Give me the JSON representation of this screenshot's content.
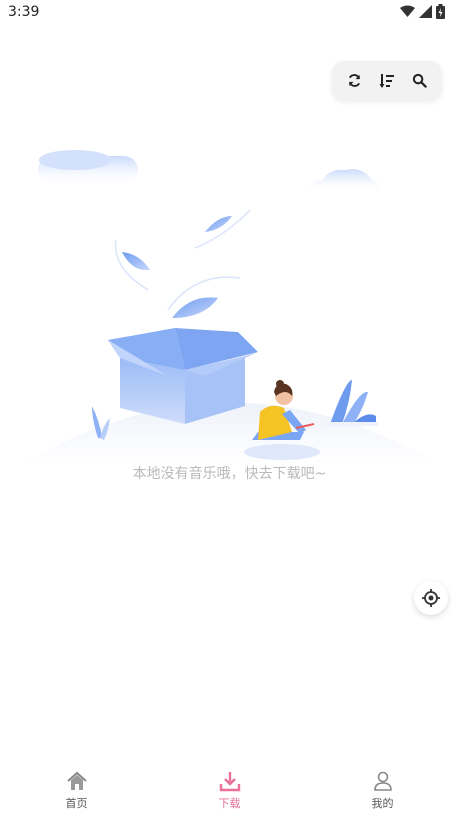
{
  "status_bar": {
    "time": "3:39",
    "icons": [
      "wifi-icon",
      "signal-icon",
      "battery-icon"
    ]
  },
  "toolbar": {
    "buttons": [
      "refresh-icon",
      "sort-icon",
      "search-icon"
    ]
  },
  "empty_state": {
    "message": "本地没有音乐哦，快去下载吧~"
  },
  "bottom_nav": {
    "items": [
      {
        "label": "首页",
        "icon": "home-icon",
        "active": false
      },
      {
        "label": "下载",
        "icon": "download-icon",
        "active": true
      },
      {
        "label": "我的",
        "icon": "user-icon",
        "active": false
      }
    ]
  },
  "colors": {
    "accent": "#e8709a",
    "illustration_blue": "#7aa6f3",
    "text_muted": "#b9b9b9"
  }
}
